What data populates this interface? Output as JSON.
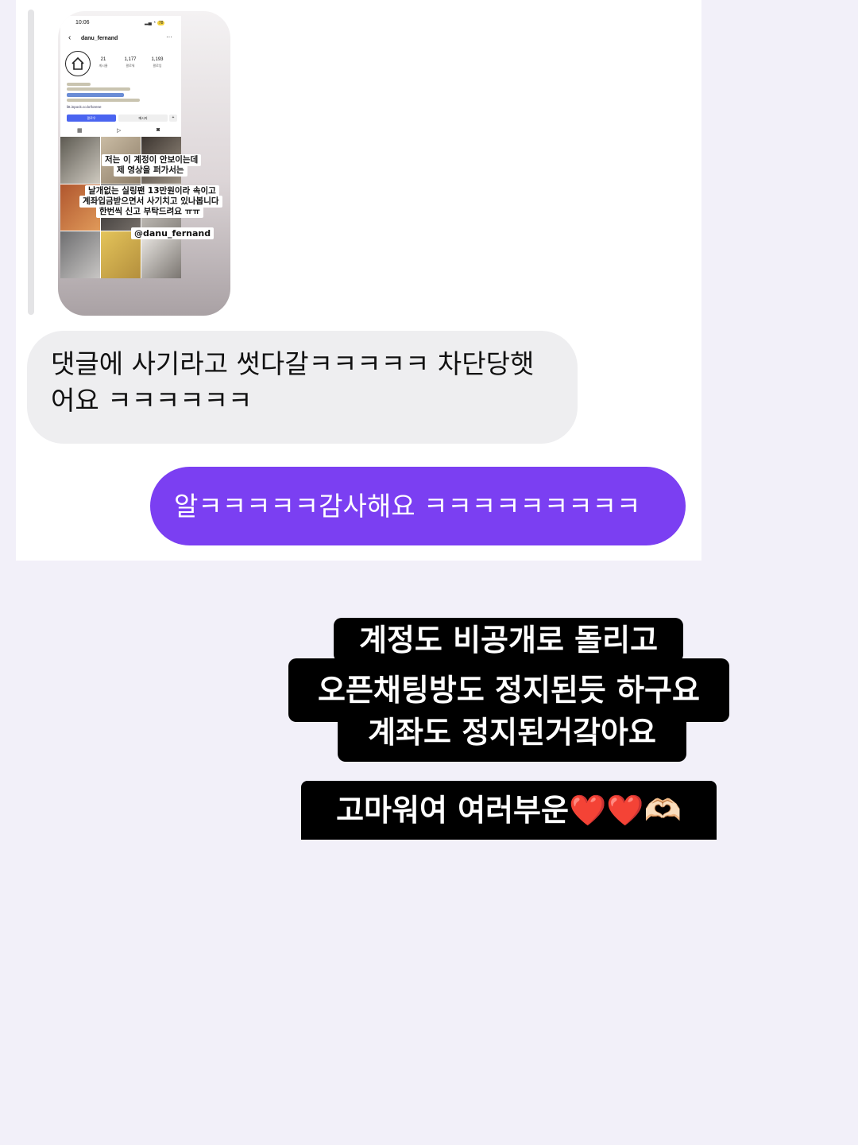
{
  "shared_post": {
    "status_time": "10:06",
    "battery": "78",
    "username": "danu_fernand",
    "stats": [
      {
        "value": "21",
        "label": "게시물"
      },
      {
        "value": "1,177",
        "label": "팔로워"
      },
      {
        "value": "1,193",
        "label": "팔로잉"
      }
    ],
    "link": "litt.inpock.co.kr/lorene",
    "follow_label": "팔로우",
    "message_label": "메시지",
    "captions": [
      "저는 이 계정이 안보이는데",
      "제 영상을 퍼가서는",
      "날개없는 실링팬 13만원이라 속이고",
      "계좌입금받으면서 사기치고 있나봅니다",
      "한번씩 신고 부탁드려요 ㅠㅠ",
      "@danu_fernand"
    ]
  },
  "messages": {
    "received": "댓글에 사기라고 썻다갈ㅋㅋㅋㅋㅋ 차단당햇어요 ㅋㅋㅋㅋㅋㅋ",
    "sent": "알ㅋㅋㅋㅋㅋ감사해요 ㅋㅋㅋㅋㅋㅋㅋㅋㅋ"
  },
  "story_text": {
    "lines": [
      "계정도 비공개로 돌리고",
      "오픈채팅방도 정지된듯 하구요",
      "계좌도 정지된거갘아요"
    ],
    "thanks": "고마워여 여러부운",
    "thanks_emoji": "❤️❤️🫶🏻"
  }
}
